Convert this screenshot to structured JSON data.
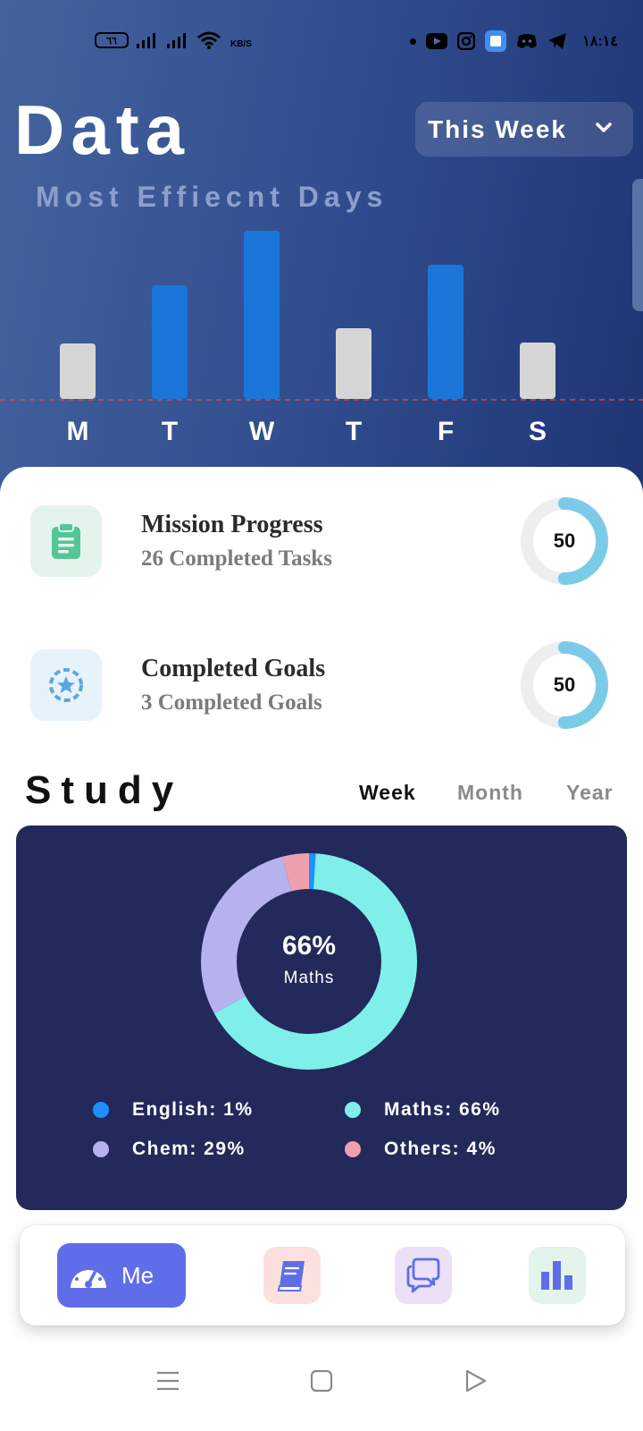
{
  "status_bar": {
    "battery": "٦٦",
    "speed_unit": "KB/S",
    "time": "١٨:١٤"
  },
  "header": {
    "title": "Data",
    "period_selector": "This Week",
    "subtitle": "Most Effiecnt Days"
  },
  "chart_data": {
    "type": "bar",
    "categories": [
      "M",
      "T",
      "W",
      "T",
      "F",
      "S"
    ],
    "values": [
      62,
      127,
      188,
      79,
      150,
      63
    ],
    "highlighted": [
      false,
      true,
      true,
      false,
      true,
      false
    ],
    "reference_line": 0,
    "colors": {
      "highlight": "#1b76d9",
      "normal": "#d6d6d6",
      "reference_line": "#d14a4a"
    }
  },
  "progress": [
    {
      "title": "Mission Progress",
      "subtitle": "26 Completed Tasks",
      "value": "50",
      "icon": "clipboard-icon"
    },
    {
      "title": "Completed Goals",
      "subtitle": "3 Completed Goals",
      "value": "50",
      "icon": "star-badge-icon"
    }
  ],
  "study": {
    "title": "Study",
    "tabs": [
      {
        "label": "Week",
        "active": true
      },
      {
        "label": "Month",
        "active": false
      },
      {
        "label": "Year",
        "active": false
      }
    ],
    "center_value": "66%",
    "center_label": "Maths",
    "legend": [
      {
        "label": "English: 1%",
        "color": "#1e90ff"
      },
      {
        "label": "Maths: 66%",
        "color": "#7ef0e9"
      },
      {
        "label": "Chem: 29%",
        "color": "#b6b2ee"
      },
      {
        "label": "Others: 4%",
        "color": "#ef9fae"
      }
    ]
  },
  "bottom_nav": {
    "me_label": "Me",
    "items": [
      "gauge-icon",
      "book-icon",
      "chat-icon",
      "bar-chart-icon"
    ]
  }
}
